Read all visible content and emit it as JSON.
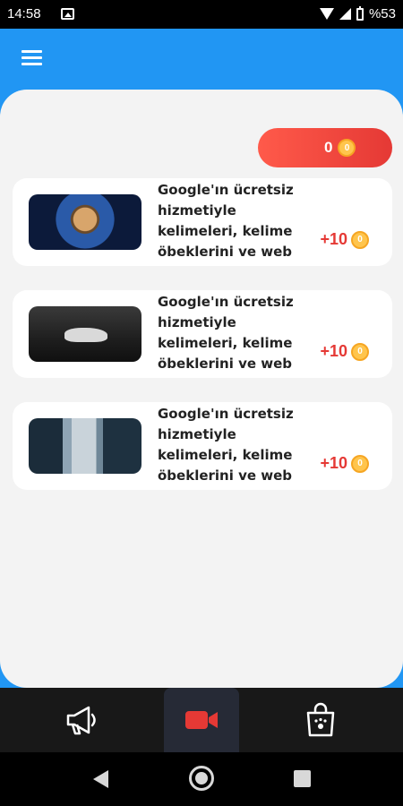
{
  "status_bar": {
    "time": "14:58",
    "battery": "%53"
  },
  "app_bar": {
    "menu_icon": "hamburger-menu-icon"
  },
  "balance": {
    "count": "0",
    "coin_icon": "coin-icon"
  },
  "tasks": [
    {
      "text": "Google'ın ücretsiz hizmetiyle kelimeleri, kelime öbeklerini ve web sayfalarını İngilizce",
      "reward": "+10",
      "thumbnail": "astronaut-cat-image"
    },
    {
      "text": "Google'ın ücretsiz hizmetiyle kelimeleri, kelime öbeklerini ve web sayfalarını İngilizce",
      "reward": "+10",
      "thumbnail": "white-wolf-image"
    },
    {
      "text": "Google'ın ücretsiz hizmetiyle kelimeleri, kelime öbeklerini ve web sayfalarını İngilizce",
      "reward": "+10",
      "thumbnail": "city-alley-image"
    }
  ],
  "bottom_nav": [
    {
      "icon": "megaphone-icon",
      "active": false
    },
    {
      "icon": "video-camera-icon",
      "active": true,
      "color": "#e53935"
    },
    {
      "icon": "shopping-bag-icon",
      "active": false
    }
  ],
  "colors": {
    "accent": "#2196F3",
    "reward": "#e53935",
    "coin": "#FFC54D"
  }
}
